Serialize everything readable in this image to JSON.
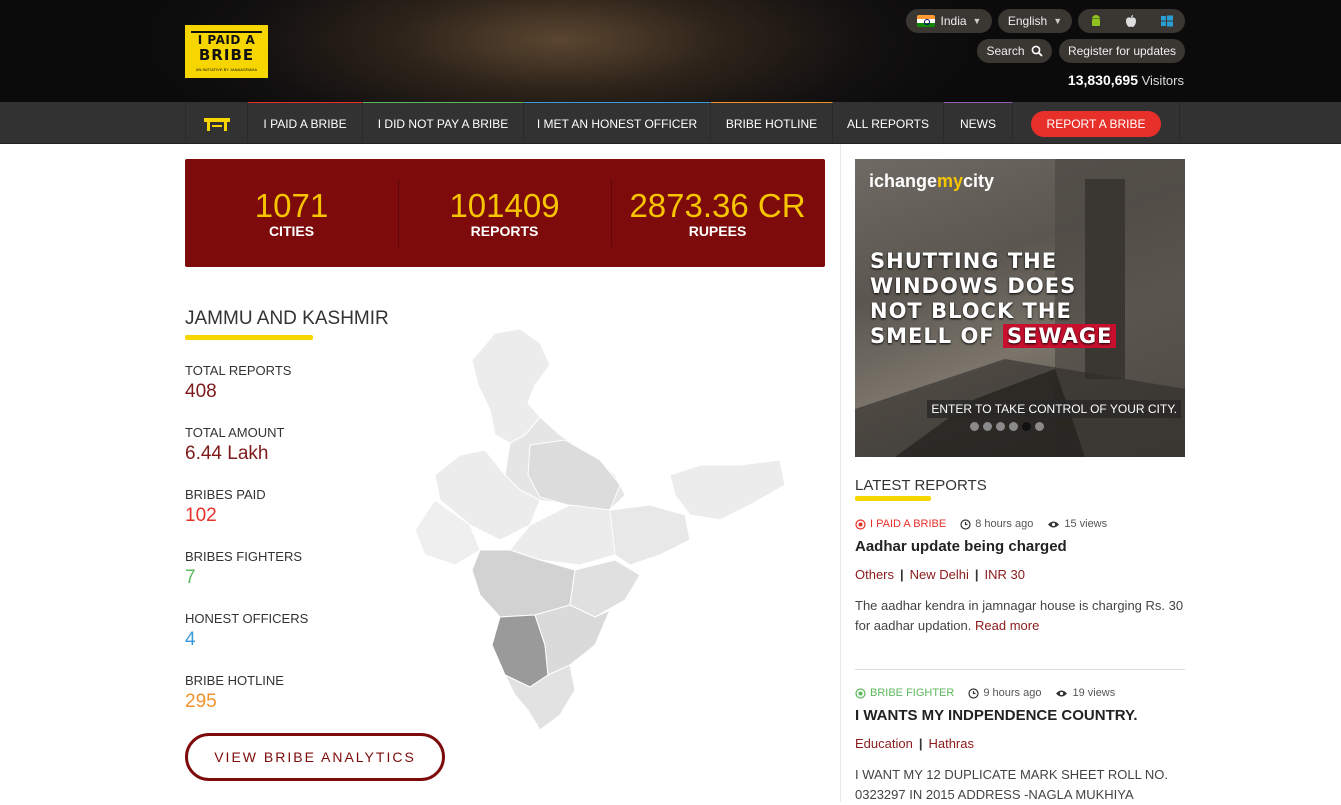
{
  "header": {
    "logo_line1": "I PAID A",
    "logo_line2": "BRIBE",
    "logo_tagline": "AN INITIATIVE BY JANAAGRAHA",
    "country": "India",
    "language": "English",
    "search_label": "Search",
    "register_label": "Register for updates",
    "visitors_count": "13,830,695",
    "visitors_label": "Visitors"
  },
  "nav": {
    "items": [
      "I PAID A BRIBE",
      "I DID NOT PAY A BRIBE",
      "I MET AN HONEST OFFICER",
      "BRIBE HOTLINE",
      "ALL REPORTS",
      "NEWS"
    ],
    "accents": [
      "#e8302a",
      "#5cb85c",
      "#3a9ad9",
      "#f0932b",
      "#9b59b6"
    ],
    "report_button": "REPORT A BRIBE"
  },
  "stats": [
    {
      "value": "1071",
      "label": "CITIES"
    },
    {
      "value": "101409",
      "label": "REPORTS"
    },
    {
      "value": "2873.36 CR",
      "label": "RUPEES"
    }
  ],
  "state": {
    "name": "JAMMU AND KASHMIR",
    "metrics": [
      {
        "label": "TOTAL REPORTS",
        "value": "408",
        "color": "#7d1a1a"
      },
      {
        "label": "TOTAL AMOUNT",
        "value": "6.44 Lakh",
        "color": "#7d1a1a"
      },
      {
        "label": "BRIBES PAID",
        "value": "102",
        "color": "#e8302a"
      },
      {
        "label": "BRIBES FIGHTERS",
        "value": "7",
        "color": "#5cb85c"
      },
      {
        "label": "HONEST OFFICERS",
        "value": "4",
        "color": "#3a9ad9"
      },
      {
        "label": "BRIBE HOTLINE",
        "value": "295",
        "color": "#f0932b"
      }
    ],
    "analytics_button": "VIEW BRIBE ANALYTICS"
  },
  "ad": {
    "brand_a": "ichange",
    "brand_b": "my",
    "brand_c": "city",
    "headline_1": "SHUTTING THE",
    "headline_2": "WINDOWS DOES",
    "headline_3": "NOT BLOCK THE",
    "headline_4a": "SMELL OF ",
    "headline_4b": "SEWAGE",
    "cta": "ENTER TO TAKE CONTROL OF YOUR CITY."
  },
  "latest": {
    "title": "LATEST REPORTS",
    "reports": [
      {
        "type": "I PAID A BRIBE",
        "type_color": "#e8302a",
        "time": "8 hours ago",
        "views": "15 views",
        "title": "Aadhar update being charged",
        "tags": [
          "Others",
          "New Delhi",
          "INR 30"
        ],
        "body": "The aadhar kendra in jamnagar house is charging Rs. 30 for aadhar updation.",
        "more": "Read more"
      },
      {
        "type": "BRIBE FIGHTER",
        "type_color": "#5cb85c",
        "time": "9 hours ago",
        "views": "19 views",
        "title": "I WANTS MY INDPENDENCE COUNTRY.",
        "tags": [
          "Education",
          "Hathras"
        ],
        "body": "I WANT MY 12 DUPLICATE MARK SHEET ROLL NO. 0323297 IN 2015 ADDRESS -NAGLA MUKHIYA"
      }
    ]
  }
}
